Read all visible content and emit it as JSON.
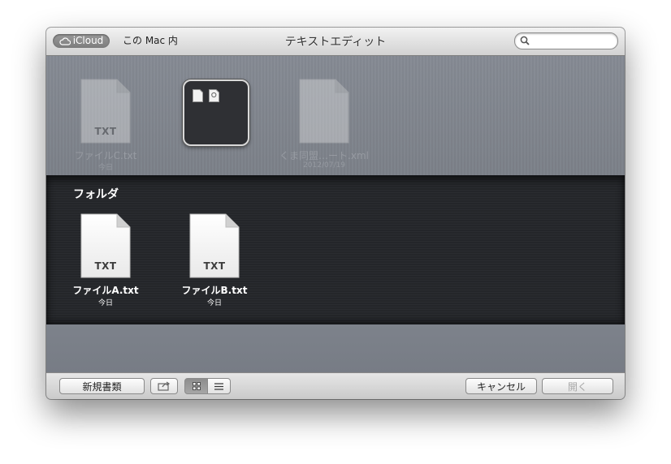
{
  "window": {
    "title": "テキストエディット"
  },
  "location": {
    "icloud_label": "iCloud",
    "mac_label": "この Mac 内"
  },
  "search": {
    "placeholder": "",
    "value": ""
  },
  "icloud_files": [
    {
      "name": "ファイルC.txt",
      "date": "今日",
      "ext": "TXT"
    },
    {
      "name": "くま同盟…ート.xml",
      "date": "2012/07/19",
      "ext": ""
    }
  ],
  "folder": {
    "title": "フォルダ",
    "files": [
      {
        "name": "ファイルA.txt",
        "date": "今日",
        "ext": "TXT"
      },
      {
        "name": "ファイルB.txt",
        "date": "今日",
        "ext": "TXT"
      }
    ]
  },
  "toolbar": {
    "new_document_label": "新規書類",
    "share_icon": "share-icon",
    "icon_view_icon": "grid-icon",
    "list_view_icon": "list-icon",
    "cancel_label": "キャンセル",
    "open_label": "開く"
  }
}
